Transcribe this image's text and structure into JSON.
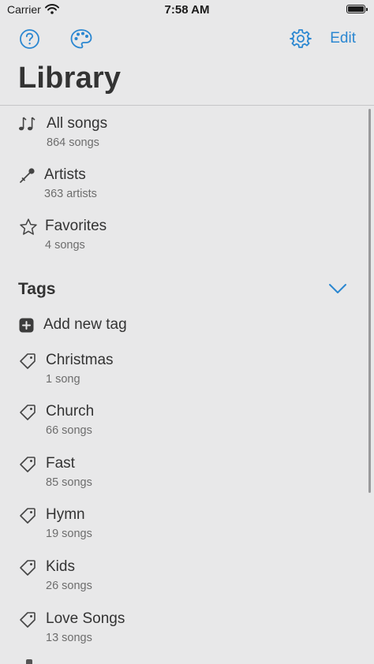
{
  "status": {
    "carrier": "Carrier",
    "time": "7:58 AM"
  },
  "nav": {
    "edit_label": "Edit"
  },
  "title": "Library",
  "library_items": [
    {
      "label": "All songs",
      "sub": "864 songs",
      "icon": "music-notes-icon"
    },
    {
      "label": "Artists",
      "sub": "363 artists",
      "icon": "microphone-icon"
    },
    {
      "label": "Favorites",
      "sub": "4 songs",
      "icon": "star-icon"
    }
  ],
  "tags_section": {
    "header": "Tags",
    "add_label": "Add new tag",
    "items": [
      {
        "label": "Christmas",
        "sub": "1 song"
      },
      {
        "label": "Church",
        "sub": "66 songs"
      },
      {
        "label": "Fast",
        "sub": "85 songs"
      },
      {
        "label": "Hymn",
        "sub": "19 songs"
      },
      {
        "label": "Kids",
        "sub": "26 songs"
      },
      {
        "label": "Love Songs",
        "sub": "13 songs"
      }
    ]
  },
  "colors": {
    "accent": "#2b87d1",
    "background": "#e8e8e9",
    "text": "#333333",
    "subtext": "#6d6d6d"
  }
}
